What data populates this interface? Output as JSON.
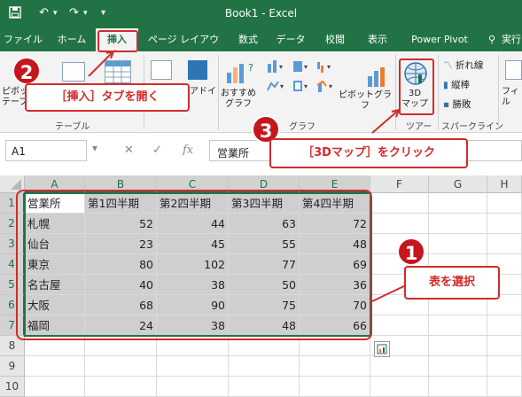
{
  "window": {
    "title": "Book1 - Excel"
  },
  "tabs": [
    "ファイル",
    "ホーム",
    "挿入",
    "ページ レイアウト",
    "数式",
    "データ",
    "校閲",
    "表示",
    "Power Pivot",
    "実行"
  ],
  "ribbon": {
    "pivot_table_label_1": "ピボッ",
    "pivot_table_label_2": "テーブ",
    "tables_group_label": "テーブル",
    "addin_label": "アドイ",
    "recommended_charts_1": "おすすめ",
    "recommended_charts_2": "グラフ",
    "pivot_chart_label": "ピボットグラフ",
    "charts_group_label": "グラフ",
    "map3d_label_1": "3D",
    "map3d_label_2": "マップ",
    "tours_group_label": "ツアー",
    "spark_line": "折れ線",
    "spark_column": "縦棒",
    "spark_winloss": "勝敗",
    "sparklines_group_label": "スパークライン",
    "filter_label": "フィル"
  },
  "formula_bar": {
    "name_box": "A1",
    "fx_label": "fx",
    "value": "営業所"
  },
  "columns": [
    "A",
    "B",
    "C",
    "D",
    "E",
    "F",
    "G",
    "H"
  ],
  "rows": [
    "1",
    "2",
    "3",
    "4",
    "5",
    "6",
    "7",
    "8",
    "9",
    "10"
  ],
  "sheet": {
    "headers": [
      "営業所",
      "第1四半期",
      "第2四半期",
      "第3四半期",
      "第4四半期"
    ],
    "records": [
      {
        "name": "札幌",
        "values": [
          "52",
          "44",
          "63",
          "72"
        ]
      },
      {
        "name": "仙台",
        "values": [
          "23",
          "45",
          "55",
          "48"
        ]
      },
      {
        "name": "東京",
        "values": [
          "80",
          "102",
          "77",
          "69"
        ]
      },
      {
        "name": "名古屋",
        "values": [
          "40",
          "38",
          "50",
          "36"
        ]
      },
      {
        "name": "大阪",
        "values": [
          "68",
          "90",
          "75",
          "70"
        ]
      },
      {
        "name": "福岡",
        "values": [
          "24",
          "38",
          "48",
          "66"
        ]
      }
    ]
  },
  "annotations": {
    "step1_number": "1",
    "step1_text": "表を選択",
    "step2_number": "2",
    "step2_text": "［挿入］タブを開く",
    "step3_number": "3",
    "step3_text": "［3Dマップ］をクリック"
  },
  "colors": {
    "excel_green": "#217346",
    "annotation_red": "#d22b2b"
  }
}
